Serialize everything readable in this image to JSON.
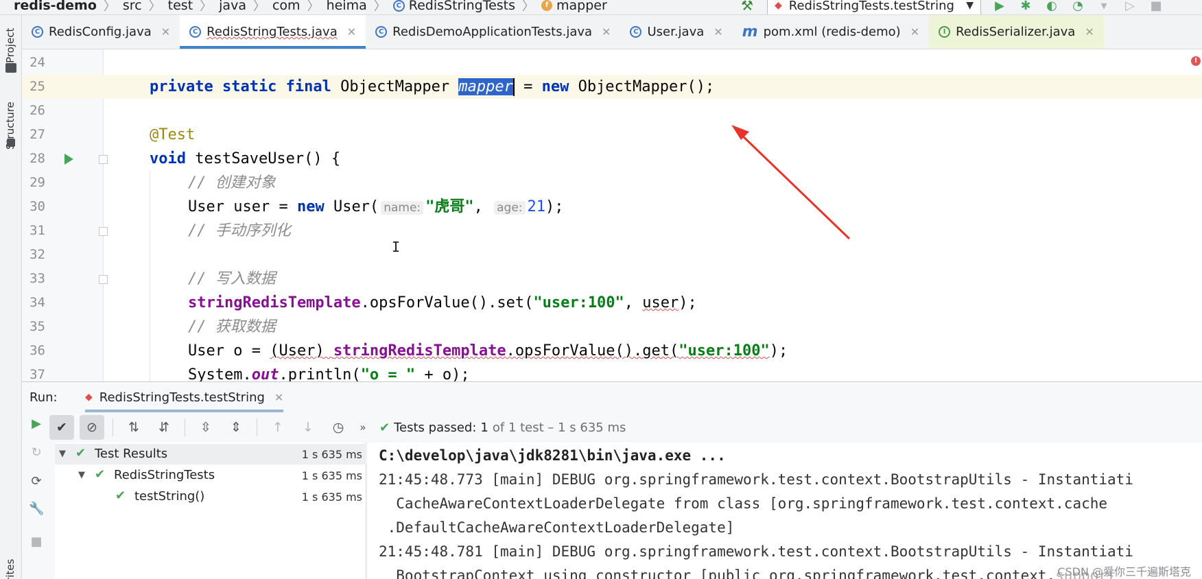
{
  "breadcrumb": {
    "items": [
      "redis-demo",
      "src",
      "test",
      "java",
      "com",
      "heima",
      "RedisStringTests",
      "mapper"
    ]
  },
  "run_config": {
    "label": "RedisStringTests.testString"
  },
  "left_strip": {
    "project": "Project",
    "structure": "Structure",
    "favorites": "vorites"
  },
  "tabs": [
    {
      "label": "RedisConfig.java",
      "icon": "class-icon"
    },
    {
      "label": "RedisStringTests.java",
      "icon": "class-icon",
      "active": true
    },
    {
      "label": "RedisDemoApplicationTests.java",
      "icon": "class-icon"
    },
    {
      "label": "User.java",
      "icon": "class-icon"
    },
    {
      "label": "pom.xml (redis-demo)",
      "icon": "maven-icon"
    },
    {
      "label": "RedisSerializer.java",
      "icon": "interface-icon"
    }
  ],
  "editor": {
    "lines": [
      {
        "num": "24"
      },
      {
        "num": "25",
        "p1": "private static final",
        "p2": " ObjectMapper ",
        "p3": "mapper",
        "p4": " = ",
        "p5": "new",
        "p6": " ObjectMapper();"
      },
      {
        "num": "26"
      },
      {
        "num": "27",
        "p1": "@Test"
      },
      {
        "num": "28",
        "p1": "void",
        "p2": " testSaveUser() {"
      },
      {
        "num": "29",
        "p1": "// 创建对象"
      },
      {
        "num": "30",
        "p1": "User user = ",
        "p2": "new",
        "p3": " User(",
        "hint1": "name:",
        "p4": "\"虎哥\"",
        "p5": ", ",
        "hint2": "age:",
        "p6": "21",
        "p7": ");"
      },
      {
        "num": "31",
        "p1": "// 手动序列化"
      },
      {
        "num": "32"
      },
      {
        "num": "33",
        "p1": "// 写入数据"
      },
      {
        "num": "34",
        "p1": "stringRedisTemplate",
        "p2": ".opsForValue().set(",
        "p3": "\"user:100\"",
        "p4": ", ",
        "p5": "user",
        "p6": ");"
      },
      {
        "num": "35",
        "p1": "// 获取数据"
      },
      {
        "num": "36",
        "p1": "User o = ",
        "p2": "(User) ",
        "p3": "stringRedisTemplate",
        "p4": ".opsForValue().get(",
        "p5": "\"user:100\"",
        "p6": ");"
      },
      {
        "num": "37",
        "p1": "System.",
        "p2": "out",
        "p3": ".println(",
        "p4": "\"o = \"",
        "p5": " + o);"
      }
    ]
  },
  "run_panel": {
    "label": "Run:",
    "tab_label": "RedisStringTests.testString",
    "status_prefix": "Tests passed:",
    "status_count": "1",
    "status_rest": "of 1 test – 1 s 635 ms",
    "tree": [
      {
        "label": "Test Results",
        "time": "1 s 635 ms"
      },
      {
        "label": "RedisStringTests",
        "time": "1 s 635 ms"
      },
      {
        "label": "testString()",
        "time": "1 s 635 ms"
      }
    ],
    "console": [
      "C:\\develop\\java\\jdk8281\\bin\\java.exe ...",
      "21:45:48.773 [main] DEBUG org.springframework.test.context.BootstrapUtils - Instantiati",
      "  CacheAwareContextLoaderDelegate from class [org.springframework.test.context.cache",
      " .DefaultCacheAwareContextLoaderDelegate]",
      "21:45:48.781 [main] DEBUG org.springframework.test.context.BootstrapUtils - Instantiati",
      "  BootstrapContext using constructor [public org.springframework.test.context.support"
    ]
  },
  "watermark": "CSDN @爱你三千遍斯塔克",
  "colors": {
    "accent": "#4083c9",
    "pass": "#4aa35a",
    "annotation_arrow": "#e8332a"
  }
}
